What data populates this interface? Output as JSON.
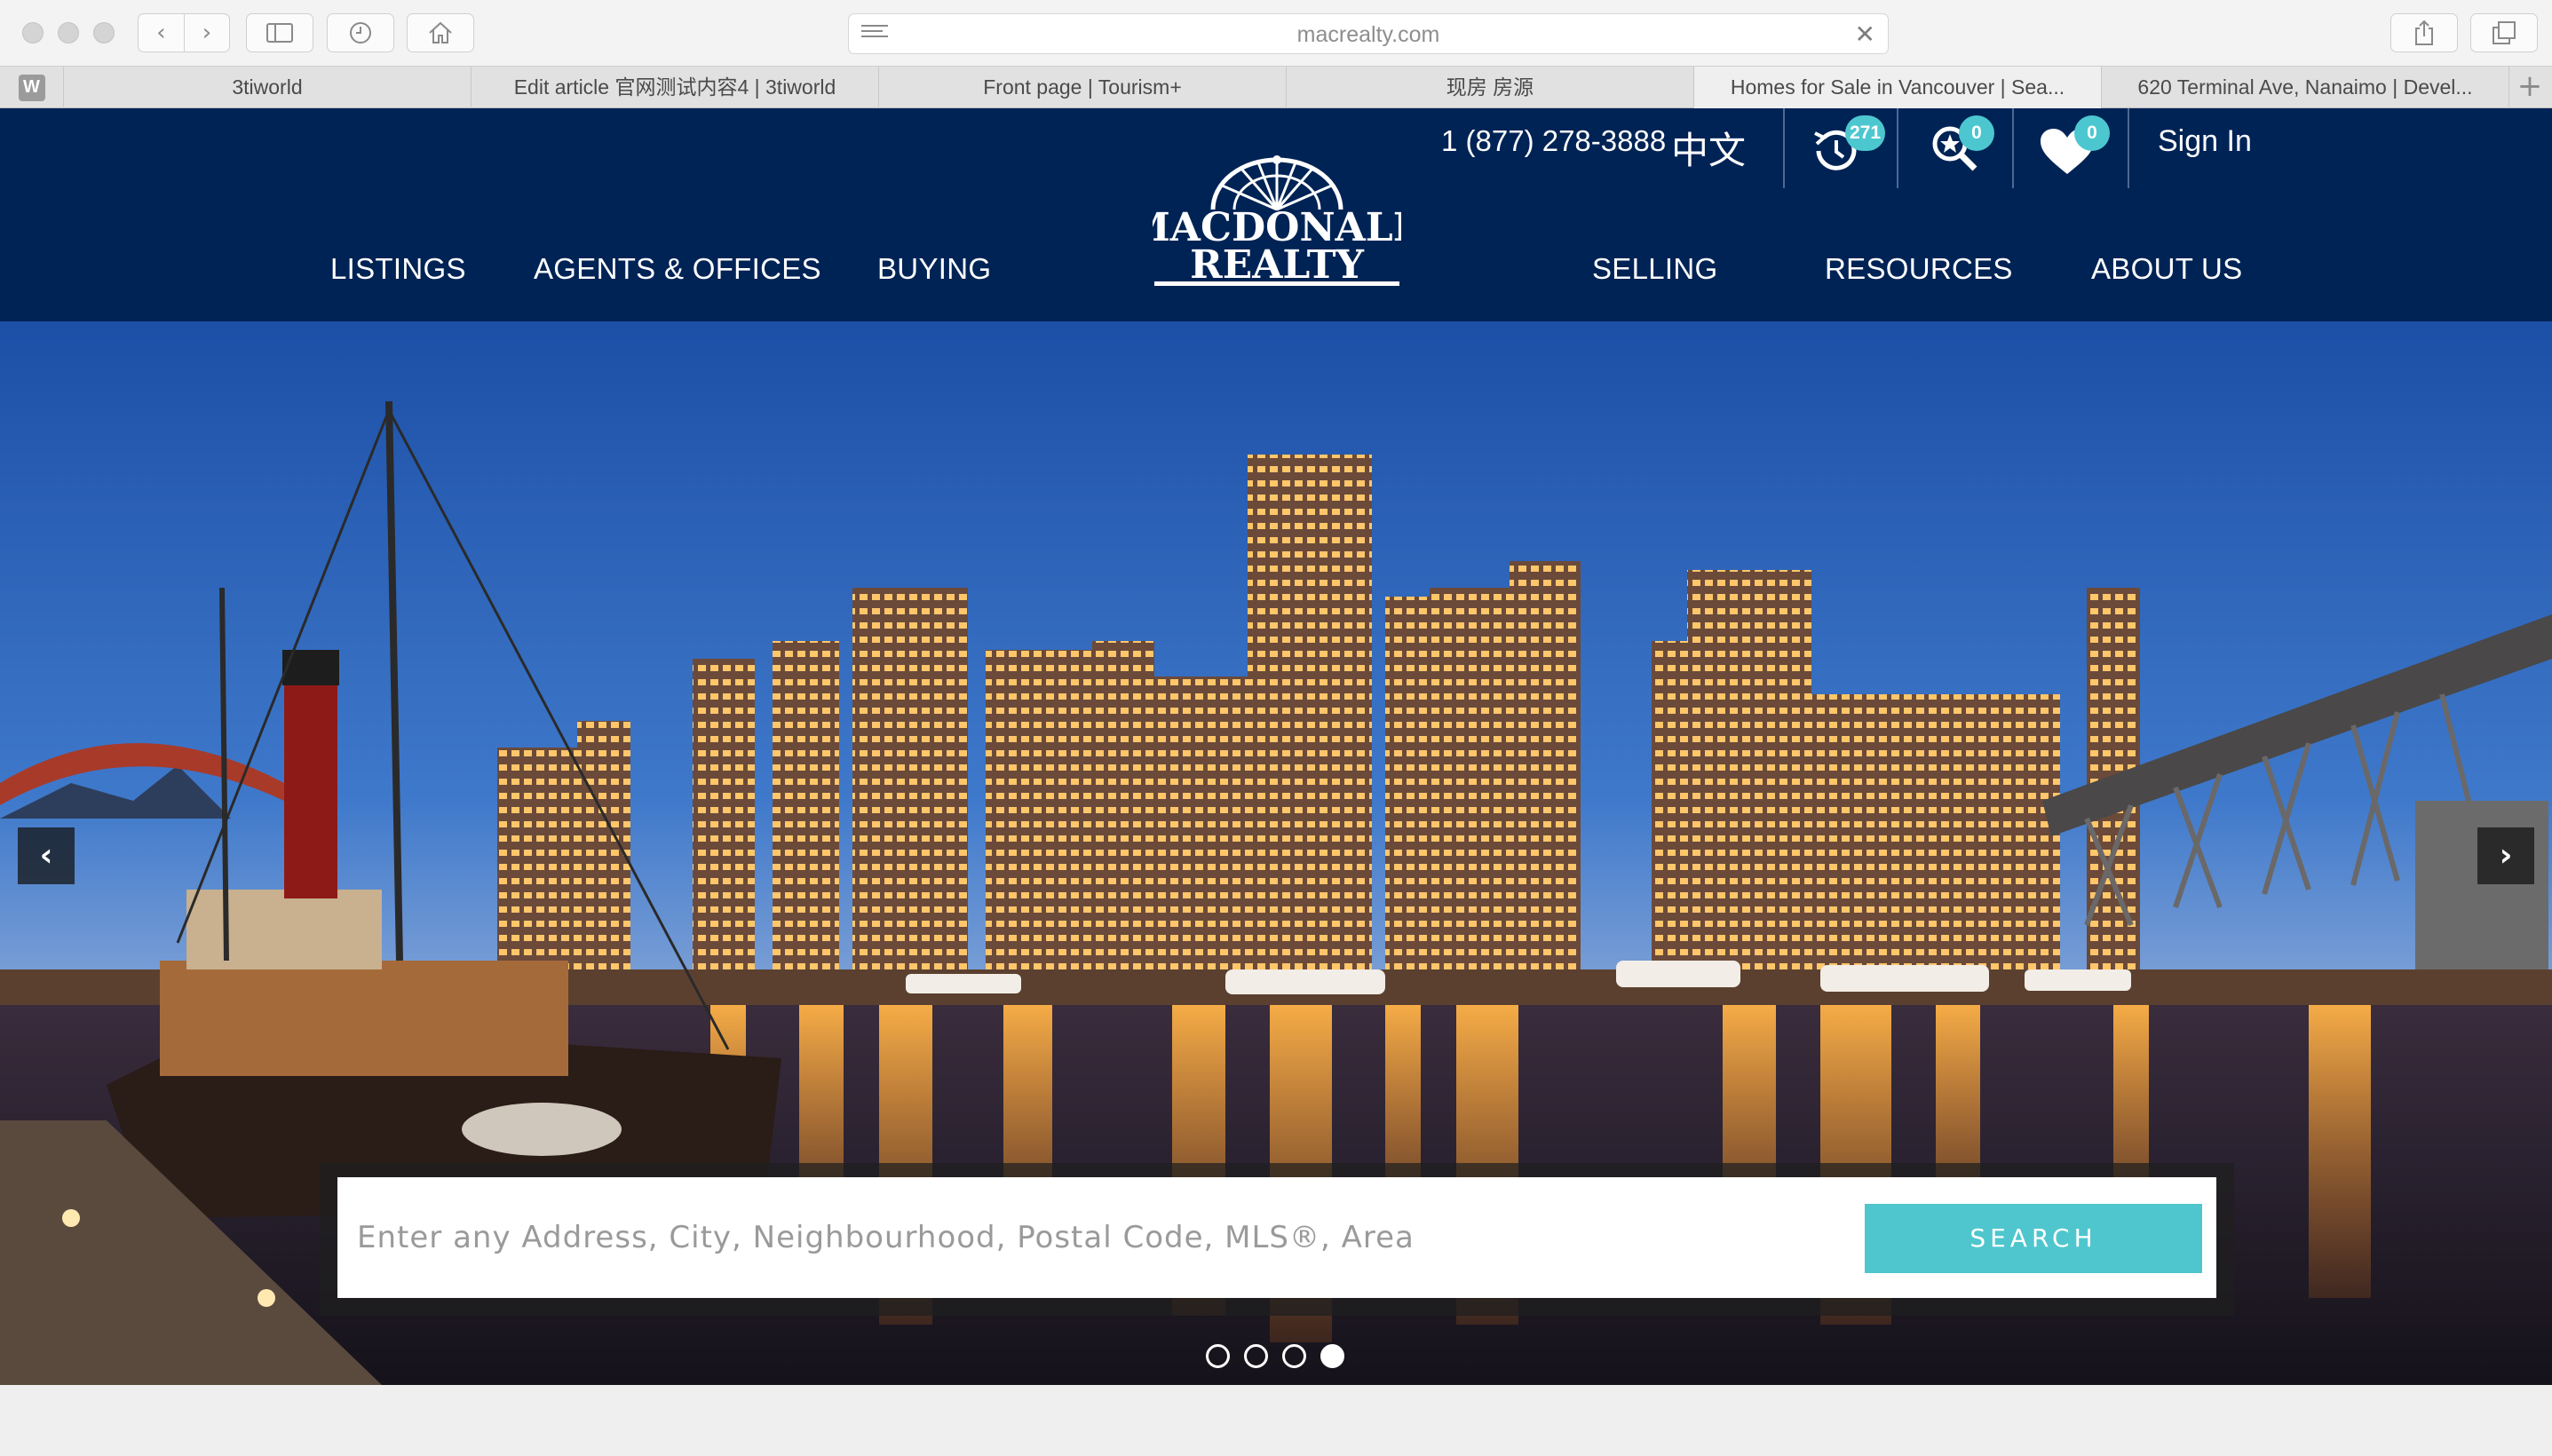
{
  "browser": {
    "url": "macrealty.com",
    "tabs": [
      {
        "title": "3tiworld"
      },
      {
        "title": "Edit article 官网测试内容4 | 3tiworld"
      },
      {
        "title": "Front page | Tourism+"
      },
      {
        "title": "现房 房源"
      },
      {
        "title": "Homes for Sale in Vancouver | Sea..."
      },
      {
        "title": "620 Terminal Ave, Nanaimo | Devel..."
      }
    ],
    "favicon_letter": "W"
  },
  "header": {
    "phone": "1 (877) 278-3888",
    "language": "中文",
    "history_count": "271",
    "saved_search_count": "0",
    "favorites_count": "0",
    "sign_in": "Sign In",
    "logo_line1": "MACDONALD",
    "logo_line2": "REALTY",
    "nav": {
      "listings": "LISTINGS",
      "agents": "AGENTS & OFFICES",
      "buying": "BUYING",
      "selling": "SELLING",
      "resources": "RESOURCES",
      "about": "ABOUT US"
    }
  },
  "hero": {
    "search_placeholder": "Enter any Address, City, Neighbourhood, Postal Code, MLS®, Area",
    "search_button": "SEARCH",
    "slides": 4,
    "active_slide": 4
  },
  "colors": {
    "header_bg": "#002355",
    "accent": "#4fc6cd",
    "badge": "#4cc7d0"
  },
  "icons": [
    "back-icon",
    "forward-icon",
    "sidebar-icon",
    "history-icon",
    "home-icon",
    "reader-icon",
    "stop-icon",
    "share-icon",
    "tabs-icon",
    "new-tab-icon",
    "clock-icon",
    "search-star-icon",
    "heart-icon",
    "prev-arrow-icon",
    "next-arrow-icon"
  ]
}
